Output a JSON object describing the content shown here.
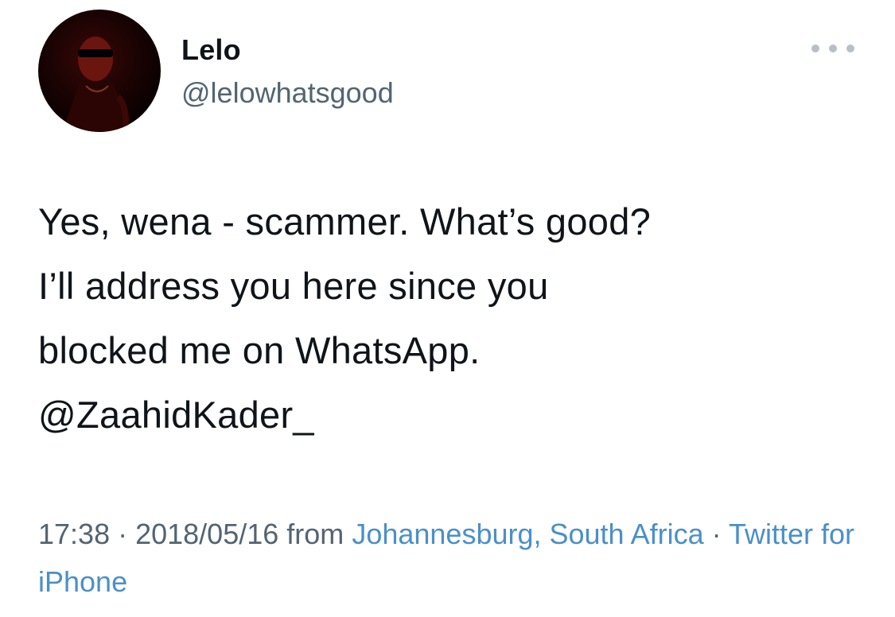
{
  "author": {
    "display_name": "Lelo",
    "handle": "@lelowhatsgood"
  },
  "tweet": {
    "text_line_1": "Yes, wena - scammer. What’s good?",
    "text_line_2": "I’ll address you here since you",
    "text_line_3": "blocked me on WhatsApp.",
    "mention": "@ZaahidKader_"
  },
  "meta": {
    "time": "17:38",
    "separator": " · ",
    "date": "2018/05/16",
    "from_label": "from",
    "location": "Johannesburg, South Africa",
    "client": "Twitter for iPhone"
  },
  "icons": {
    "more": "more-horizontal-icon"
  },
  "colors": {
    "text_primary": "#0f1419",
    "text_secondary": "#536471",
    "link": "#4a90c8",
    "more_dots": "#b7c0c7"
  }
}
